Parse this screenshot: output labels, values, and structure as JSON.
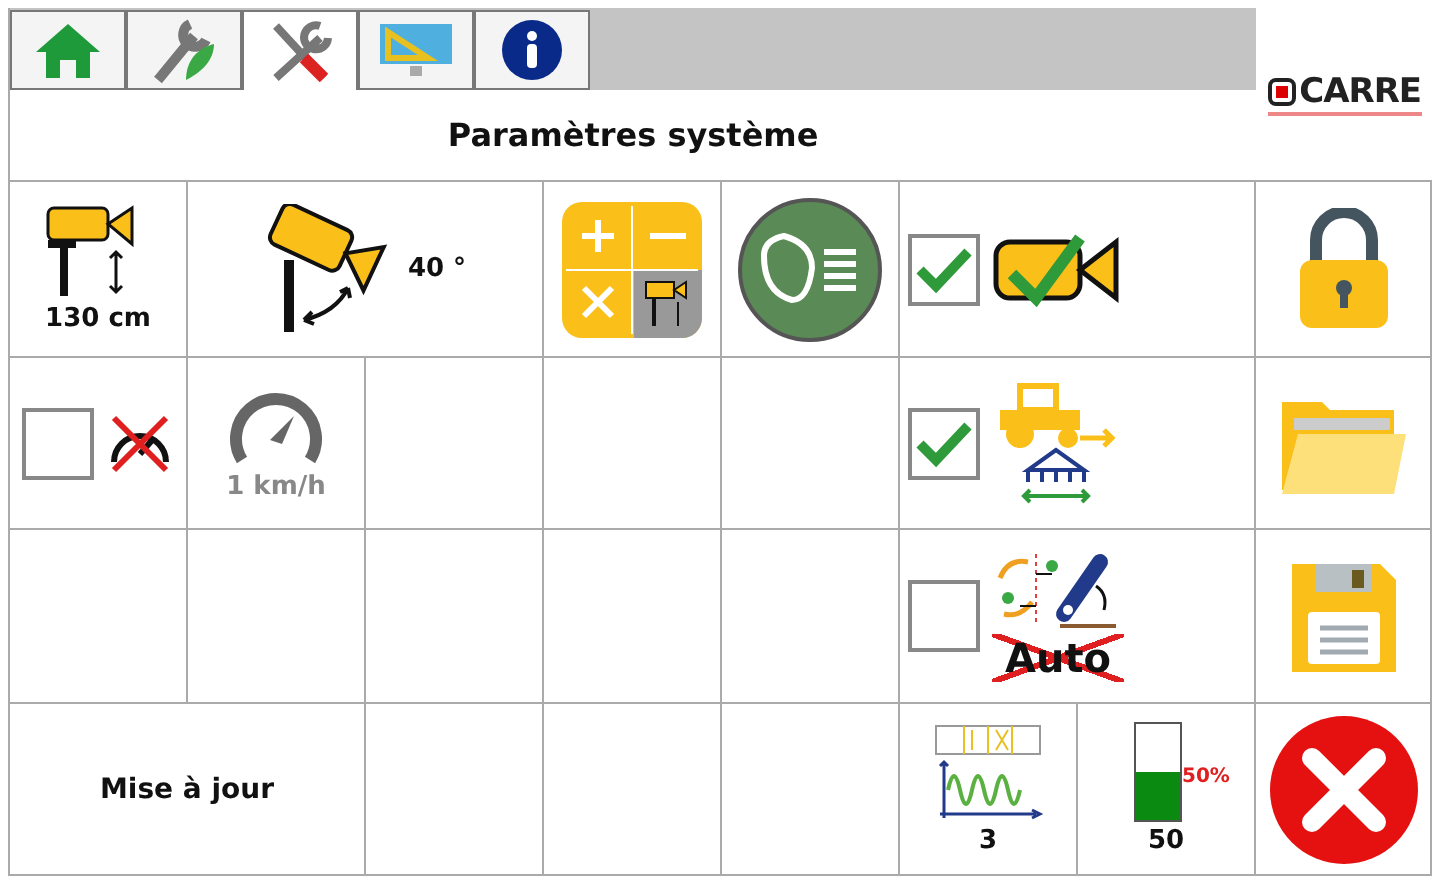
{
  "tabs": [
    {
      "kind": "home",
      "selected": false
    },
    {
      "kind": "agronomy",
      "selected": false
    },
    {
      "kind": "tools",
      "selected": true
    },
    {
      "kind": "display",
      "selected": false
    },
    {
      "kind": "info",
      "selected": false
    }
  ],
  "logo": "CARRE",
  "title": "Paramètres système",
  "camera_height": {
    "value": "130 cm"
  },
  "camera_angle": {
    "value": "40 °"
  },
  "camera_option": {
    "checked": true
  },
  "speed_option": {
    "checked": false
  },
  "speed": {
    "value": "1 km/h",
    "disabled": true
  },
  "tractor_option": {
    "checked": true
  },
  "auto_option": {
    "checked": false,
    "label": "Auto"
  },
  "update": {
    "label": "Mise à jour"
  },
  "hydraulic": {
    "value": "3"
  },
  "tank": {
    "value": "50",
    "level": 0.5,
    "marker": "50%"
  },
  "side_buttons": [
    {
      "kind": "lock"
    },
    {
      "kind": "folder"
    },
    {
      "kind": "save"
    },
    {
      "kind": "cancel"
    }
  ]
}
